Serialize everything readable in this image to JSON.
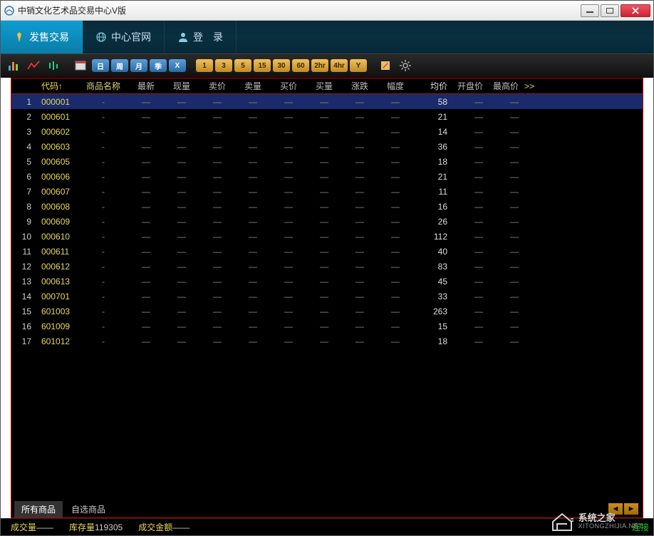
{
  "window": {
    "title": "中销文化艺术品交易中心V版"
  },
  "tabs": [
    {
      "label": "发售交易",
      "active": true,
      "icon": "badge"
    },
    {
      "label": "中心官网",
      "active": false,
      "icon": "globe"
    },
    {
      "label": "登　录",
      "active": false,
      "icon": "user"
    }
  ],
  "toolbar_time_badges": [
    "日",
    "周",
    "月",
    "季",
    "X"
  ],
  "toolbar_num_badges": [
    "1",
    "3",
    "5",
    "15",
    "30",
    "60",
    "2hr",
    "4hr",
    "Y"
  ],
  "columns": [
    "代码↑",
    "商品名称",
    "最新",
    "现量",
    "卖价",
    "卖量",
    "买价",
    "买量",
    "涨跌",
    "幅度",
    "均价",
    "开盘价",
    "最高价",
    ">>"
  ],
  "rows": [
    {
      "n": 1,
      "code": "000001",
      "avg": 58,
      "sel": true
    },
    {
      "n": 2,
      "code": "000601",
      "avg": 21
    },
    {
      "n": 3,
      "code": "000602",
      "avg": 14
    },
    {
      "n": 4,
      "code": "000603",
      "avg": 36
    },
    {
      "n": 5,
      "code": "000605",
      "avg": 18
    },
    {
      "n": 6,
      "code": "000606",
      "avg": 21
    },
    {
      "n": 7,
      "code": "000607",
      "avg": 11
    },
    {
      "n": 8,
      "code": "000608",
      "avg": 16
    },
    {
      "n": 9,
      "code": "000609",
      "avg": 26
    },
    {
      "n": 10,
      "code": "000610",
      "avg": 112
    },
    {
      "n": 11,
      "code": "000611",
      "avg": 40
    },
    {
      "n": 12,
      "code": "000612",
      "avg": 83
    },
    {
      "n": 13,
      "code": "000613",
      "avg": 45
    },
    {
      "n": 14,
      "code": "000701",
      "avg": 33
    },
    {
      "n": 15,
      "code": "601003",
      "avg": 263
    },
    {
      "n": 16,
      "code": "601009",
      "avg": 15
    },
    {
      "n": 17,
      "code": "601012",
      "avg": 18
    }
  ],
  "lower_tabs": [
    {
      "label": "所有商品",
      "active": true
    },
    {
      "label": "自选商品",
      "active": false
    }
  ],
  "status": {
    "vol_label": "成交量",
    "vol_value": "——",
    "inv_label": "库存量",
    "inv_value": "119305",
    "amt_label": "成交金额",
    "amt_value": "——",
    "conn": "连接"
  },
  "watermark": {
    "name": "系统之家",
    "url": "XITONGZHIJIA.NET"
  },
  "dash": "—"
}
